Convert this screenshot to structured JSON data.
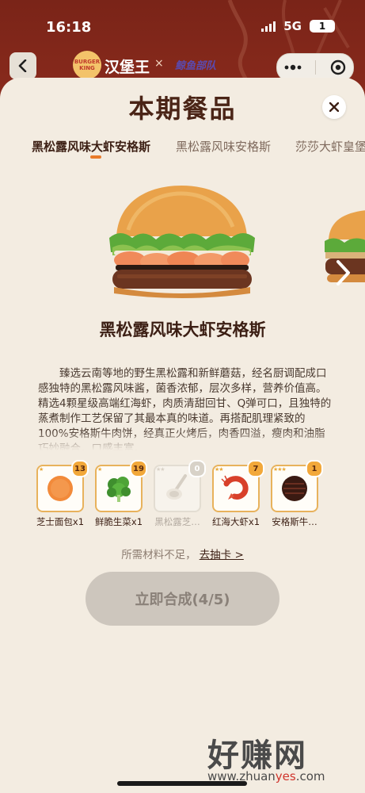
{
  "status_bar": {
    "time": "16:18",
    "network": "5G",
    "battery": "1"
  },
  "header": {
    "brand_name": "汉堡王",
    "logo_text": "BURGER KING",
    "times": "×",
    "collab_name": "鲸鱼部队"
  },
  "panel": {
    "title": "本期餐品",
    "tabs": [
      {
        "label": "黑松露风味大虾安格斯",
        "active": true
      },
      {
        "label": "黑松露风味安格斯",
        "active": false
      },
      {
        "label": "莎莎大虾皇堡",
        "active": false
      }
    ]
  },
  "product": {
    "name": "黑松露风味大虾安格斯",
    "description": "臻选云南等地的野生黑松露和新鲜蘑菇，经名厨调配成口感独特的黑松露风味酱，菌香浓郁，层次多样，营养价值高。精选4颗星级高端红海虾，肉质清甜回甘、Q弹可口，且独特的蒸煮制作工艺保留了其最本真的味道。再搭配肌理紧致的100%安格斯牛肉饼，经真正火烤后，肉香四溢，瘦肉和油脂巧妙融合，口感丰富。"
  },
  "ingredients": [
    {
      "label": "芝士面包x1",
      "count": "13",
      "stars": "★",
      "icon": "bun-icon",
      "owned": true
    },
    {
      "label": "鲜脆生菜x1",
      "count": "19",
      "stars": "★",
      "icon": "lettuce-icon",
      "owned": true
    },
    {
      "label": "黑松露芝…",
      "count": "0",
      "stars": "★★",
      "icon": "truffle-sauce-icon",
      "owned": false
    },
    {
      "label": "红海大虾x1",
      "count": "7",
      "stars": "★★",
      "icon": "shrimp-icon",
      "owned": true
    },
    {
      "label": "安格斯牛…",
      "count": "1",
      "stars": "★★★",
      "icon": "beef-patty-icon",
      "owned": true
    }
  ],
  "hint": {
    "text": "所需材料不足，",
    "link": "去抽卡 >"
  },
  "synthesize_button": {
    "label": "立即合成(4/5)"
  },
  "watermark": {
    "cn": "好赚网",
    "url_prefix": "www.zhuan",
    "url_red": "yes",
    "url_suffix": ".com"
  },
  "colors": {
    "accent": "#e97b2a",
    "brand_red": "#8a2a1c",
    "panel_bg": "#f3ece1"
  }
}
